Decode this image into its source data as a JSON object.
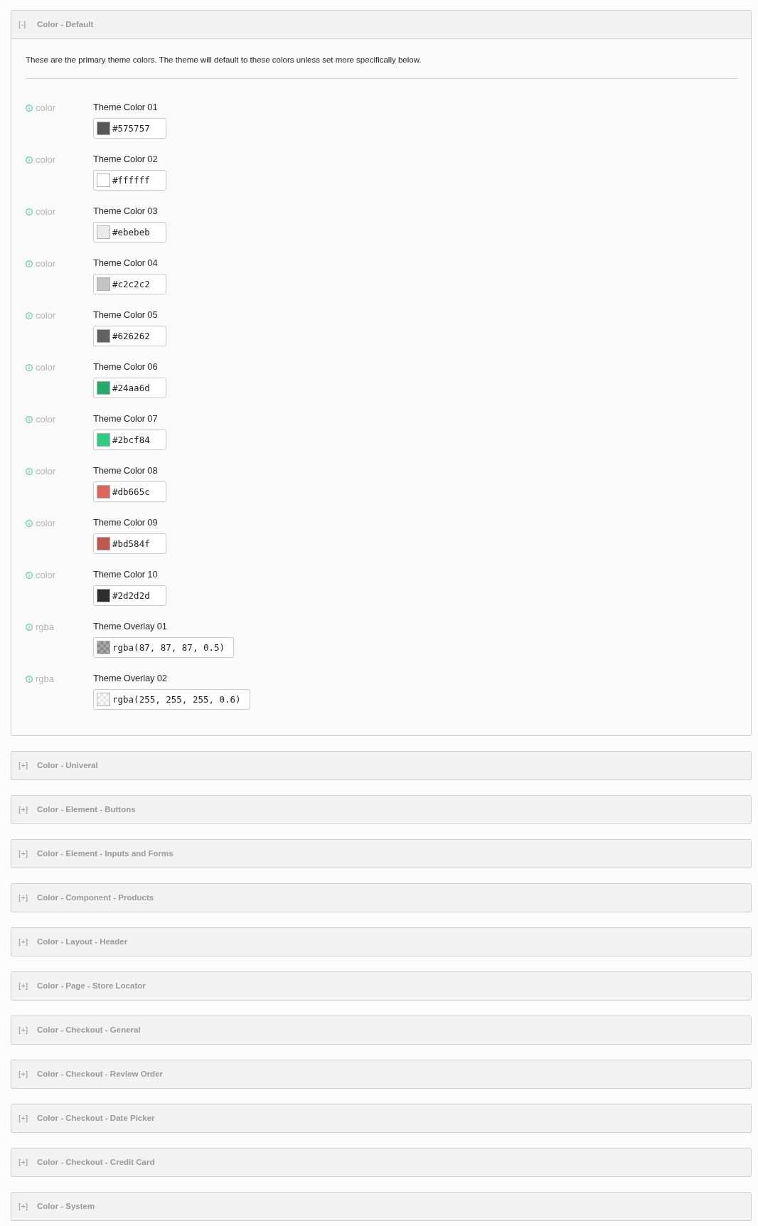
{
  "panels": [
    {
      "toggle": "[-]",
      "title": "Color - Default",
      "expanded": true,
      "description": "These are the primary theme colors. The theme will default to these colors unless set more specifically below.",
      "fields": [
        {
          "type": "color",
          "label": "Theme Color 01",
          "value": "#575757"
        },
        {
          "type": "color",
          "label": "Theme Color 02",
          "value": "#ffffff"
        },
        {
          "type": "color",
          "label": "Theme Color 03",
          "value": "#ebebeb"
        },
        {
          "type": "color",
          "label": "Theme Color 04",
          "value": "#c2c2c2"
        },
        {
          "type": "color",
          "label": "Theme Color 05",
          "value": "#626262"
        },
        {
          "type": "color",
          "label": "Theme Color 06",
          "value": "#24aa6d"
        },
        {
          "type": "color",
          "label": "Theme Color 07",
          "value": "#2bcf84"
        },
        {
          "type": "color",
          "label": "Theme Color 08",
          "value": "#db665c"
        },
        {
          "type": "color",
          "label": "Theme Color 09",
          "value": "#bd584f"
        },
        {
          "type": "color",
          "label": "Theme Color 10",
          "value": "#2d2d2d"
        },
        {
          "type": "rgba",
          "label": "Theme Overlay 01",
          "value": "rgba(87, 87, 87, 0.5)"
        },
        {
          "type": "rgba",
          "label": "Theme Overlay 02",
          "value": "rgba(255, 255, 255, 0.6)"
        }
      ]
    },
    {
      "toggle": "[+]",
      "title": "Color - Univeral",
      "expanded": false
    },
    {
      "toggle": "[+]",
      "title": "Color - Element - Buttons",
      "expanded": false
    },
    {
      "toggle": "[+]",
      "title": "Color - Element - Inputs and Forms",
      "expanded": false
    },
    {
      "toggle": "[+]",
      "title": "Color - Component - Products",
      "expanded": false
    },
    {
      "toggle": "[+]",
      "title": "Color - Layout - Header",
      "expanded": false
    },
    {
      "toggle": "[+]",
      "title": "Color - Page - Store Locator",
      "expanded": false
    },
    {
      "toggle": "[+]",
      "title": "Color - Checkout - General",
      "expanded": false
    },
    {
      "toggle": "[+]",
      "title": "Color - Checkout - Review Order",
      "expanded": false
    },
    {
      "toggle": "[+]",
      "title": "Color - Checkout - Date Picker",
      "expanded": false
    },
    {
      "toggle": "[+]",
      "title": "Color - Checkout - Credit Card",
      "expanded": false
    },
    {
      "toggle": "[+]",
      "title": "Color - System",
      "expanded": false
    }
  ]
}
